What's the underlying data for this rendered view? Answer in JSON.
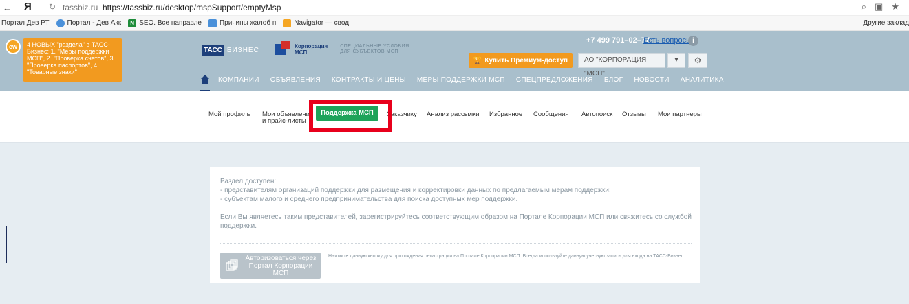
{
  "browser": {
    "back": "←",
    "ya": "Я",
    "reload": "↻",
    "domain": "tassbiz.ru",
    "url": "https://tassbiz.ru/desktop/mspSupport/emptyMsp"
  },
  "bookmarks": {
    "items": [
      {
        "label": "Портал Дев РТ",
        "color": "#ffffff"
      },
      {
        "label": "Портал - Дев Акк",
        "color": "#4a90d9"
      },
      {
        "label": "SEO. Все направле",
        "color": "#1e8c3a",
        "glyph": "N"
      },
      {
        "label": "Причины жалоб п",
        "color": "#4a90d9"
      },
      {
        "label": "Navigator — свод",
        "color": "#f5a623"
      }
    ],
    "other": "Другие заклад"
  },
  "header": {
    "new_badge": "ew",
    "promo_text": "4 НОВЫХ \"раздела\" в ТАСС-Бизнес: 1. \"Меры поддержки МСП\", 2. \"Проверка счетов\", 3. \"Проверка паспортов\", 4. \"Товарные знаки\"",
    "logo_tass": "ТАСС",
    "logo_biz": "БИЗНЕС",
    "corp_line1": "Корпорация",
    "corp_line2": "МСП",
    "special_line1": "СПЕЦИАЛЬНЫЕ УСЛОВИЯ",
    "special_line2": "ДЛЯ СУБЪЕКТОВ МСП",
    "phone": "+7 499 791–02–77",
    "questions": "Есть вопросы?",
    "info": "i",
    "premium": "Купить Премиум-доступ",
    "org": "АО \"КОРПОРАЦИЯ \"МСП\"",
    "org_arrow": "▾",
    "gear": "⚙",
    "nav": [
      "КОМПАНИИ",
      "ОБЪЯВЛЕНИЯ",
      "КОНТРАКТЫ И ЦЕНЫ",
      "МЕРЫ ПОДДЕРЖКИ МСП",
      "СПЕЦПРЕДЛОЖЕНИЯ",
      "БЛОГ",
      "НОВОСТИ",
      "АНАЛИТИКА"
    ]
  },
  "subnav": {
    "profile": "Мой профиль",
    "ads_line1": "Мои объявления",
    "ads_line2": "и прайс-листы",
    "msp": "Поддержка МСП",
    "customer": "Заказчику",
    "analysis": "Анализ рассылки",
    "favorites": "Избранное",
    "messages": "Сообщения",
    "autosearch": "Автопоиск",
    "reviews": "Отзывы",
    "partners": "Мои партнеры"
  },
  "card": {
    "line1": "Раздел доступен:",
    "line2": "- представителям организаций поддержки для размещения и корректировки данных по предлагаемым мерам поддержки;",
    "line3": "- субъектам малого и среднего предпринимательства для поиска доступных мер поддержки.",
    "line4": "Если Вы являетесь таким представителей, зарегистрируйтесь соответствующим образом на Портале Корпорации МСП или свяжитесь со службой поддержки.",
    "auth_button": "Авторизоваться через Портал Корпорации МСП",
    "hint": "Нажмите данную кнопку для прохождения регистрации на Портале Корпорации МСП. Всегда используйте данную учетную запись для входа на ТАСС-Бизнес"
  }
}
